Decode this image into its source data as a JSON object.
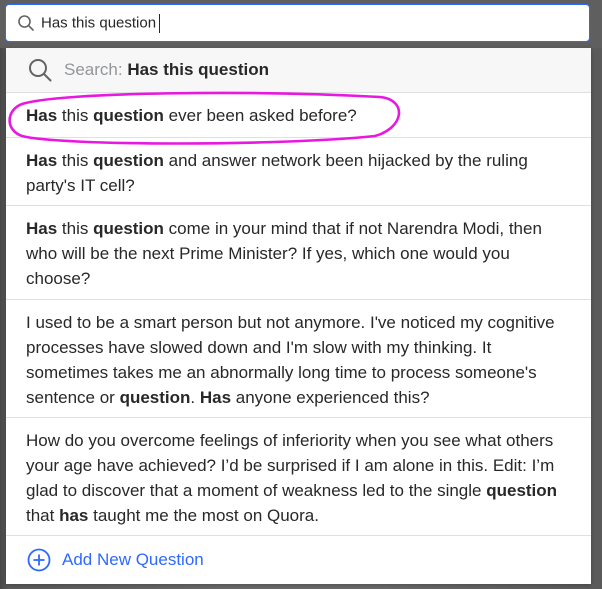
{
  "search": {
    "value": "Has this question",
    "icon": "search-icon"
  },
  "dropdown": {
    "search_prefix": "Search: ",
    "search_query": "Has this question",
    "suggestions": [
      {
        "segments": [
          {
            "t": "Has",
            "b": true
          },
          {
            "t": " this ",
            "b": false
          },
          {
            "t": "question",
            "b": true
          },
          {
            "t": " ever been asked before?",
            "b": false
          }
        ],
        "circled": true
      },
      {
        "segments": [
          {
            "t": "Has",
            "b": true
          },
          {
            "t": " this ",
            "b": false
          },
          {
            "t": "question",
            "b": true
          },
          {
            "t": " and answer network been hijacked by the ruling party's IT cell?",
            "b": false
          }
        ]
      },
      {
        "segments": [
          {
            "t": "Has",
            "b": true
          },
          {
            "t": " this ",
            "b": false
          },
          {
            "t": "question",
            "b": true
          },
          {
            "t": " come in your mind that if not Narendra Modi, then who will be the next Prime Minister? If yes, which one would you choose?",
            "b": false
          }
        ]
      },
      {
        "segments": [
          {
            "t": "I used to be a smart person but not anymore. I've noticed my cognitive processes have slowed down and I'm slow with my thinking. It sometimes takes me an abnormally long time to process someone's sentence or ",
            "b": false
          },
          {
            "t": "question",
            "b": true
          },
          {
            "t": ". ",
            "b": false
          },
          {
            "t": "Has",
            "b": true
          },
          {
            "t": " anyone experienced this?",
            "b": false
          }
        ]
      },
      {
        "segments": [
          {
            "t": "How do you overcome feelings of inferiority when you see what others your age have achieved? I’d be surprised if I am alone in this. Edit: I’m glad to discover that a moment of weakness led to the single ",
            "b": false
          },
          {
            "t": "question",
            "b": true
          },
          {
            "t": " that ",
            "b": false
          },
          {
            "t": "has",
            "b": true
          },
          {
            "t": " taught me the most on Quora.",
            "b": false
          }
        ]
      }
    ],
    "add_label": "Add New Question",
    "add_icon": "plus-circle-icon"
  },
  "colors": {
    "accent": "#2e69ff",
    "circle_annotation": "#e818e0"
  }
}
